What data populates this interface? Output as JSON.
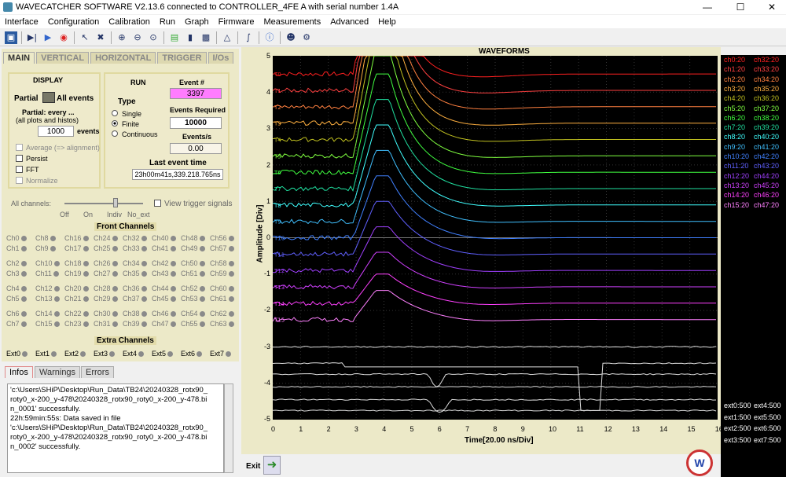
{
  "window": {
    "title": "WAVECATCHER SOFTWARE V2.13.6 connected to CONTROLLER_4FE A with serial number 1.4A"
  },
  "menu": [
    "Interface",
    "Configuration",
    "Calibration",
    "Run",
    "Graph",
    "Firmware",
    "Measurements",
    "Advanced",
    "Help"
  ],
  "tabs": [
    "MAIN",
    "VERTICAL",
    "HORIZONTAL",
    "TRIGGER",
    "I/Os"
  ],
  "display": {
    "header": "DISPLAY",
    "partial": "Partial",
    "all_events": "All events",
    "partial_every": "Partial: every ...",
    "all_plots": "(all plots and histos)",
    "events_value": "1000",
    "events_label": "events",
    "average": "Average (=> alignment)",
    "persist": "Persist",
    "fft": "FFT",
    "normalize": "Normalize"
  },
  "run": {
    "header": "RUN",
    "type": "Type",
    "single": "Single",
    "finite": "Finite",
    "continuous": "Continuous",
    "event_num_label": "Event #",
    "event_num": "3397",
    "events_required_label": "Events Required",
    "events_required": "10000",
    "events_per_s_label": "Events/s",
    "events_per_s": "0.00",
    "last_event_label": "Last event time",
    "last_event": "23h00m41s,339.218.765ns"
  },
  "channels": {
    "all_channels": "All channels:",
    "off": "Off",
    "on": "On",
    "indiv": "Indiv",
    "no_ext": "No_ext",
    "view_trigger": "View trigger signals",
    "front": "Front Channels",
    "extra": "Extra Channels",
    "rows": [
      [
        "Ch0",
        "Ch8",
        "Ch16",
        "Ch24",
        "Ch32",
        "Ch40",
        "Ch48",
        "Ch56"
      ],
      [
        "Ch1",
        "Ch9",
        "Ch17",
        "Ch25",
        "Ch33",
        "Ch41",
        "Ch49",
        "Ch57"
      ],
      [
        "Ch2",
        "Ch10",
        "Ch18",
        "Ch26",
        "Ch34",
        "Ch42",
        "Ch50",
        "Ch58"
      ],
      [
        "Ch3",
        "Ch11",
        "Ch19",
        "Ch27",
        "Ch35",
        "Ch43",
        "Ch51",
        "Ch59"
      ],
      [
        "Ch4",
        "Ch12",
        "Ch20",
        "Ch28",
        "Ch36",
        "Ch44",
        "Ch52",
        "Ch60"
      ],
      [
        "Ch5",
        "Ch13",
        "Ch21",
        "Ch29",
        "Ch37",
        "Ch45",
        "Ch53",
        "Ch61"
      ],
      [
        "Ch6",
        "Ch14",
        "Ch22",
        "Ch30",
        "Ch38",
        "Ch46",
        "Ch54",
        "Ch62"
      ],
      [
        "Ch7",
        "Ch15",
        "Ch23",
        "Ch31",
        "Ch39",
        "Ch47",
        "Ch55",
        "Ch63"
      ]
    ],
    "ext": [
      "Ext0",
      "Ext1",
      "Ext2",
      "Ext3",
      "Ext4",
      "Ext5",
      "Ext6",
      "Ext7"
    ]
  },
  "info_tabs": [
    "Infos",
    "Warnings",
    "Errors"
  ],
  "info_lines": [
    "'c:\\Users\\SHiP\\Desktop\\Run_Data\\TB24\\20240328_rotx90_",
    "roty0_x-200_y-478\\20240328_rotx90_roty0_x-200_y-478.bi",
    "n_0001' successfully.",
    "22h:59min:55s: Data saved in file",
    "'c:\\Users\\SHiP\\Desktop\\Run_Data\\TB24\\20240328_rotx90_",
    "roty0_x-200_y-478\\20240328_rotx90_roty0_x-200_y-478.bi",
    "n_0002' successfully."
  ],
  "plot": {
    "title": "WAVEFORMS",
    "ylabel": "Amplitude [Div]",
    "xlabel": "Time[20.00 ns/Div]",
    "yticks": [
      "5",
      "4",
      "3",
      "2",
      "1",
      "0",
      "-1",
      "-2",
      "-3",
      "-4",
      "-5"
    ],
    "xticks": [
      "0",
      "1",
      "2",
      "3",
      "4",
      "5",
      "6",
      "7",
      "8",
      "9",
      "10",
      "11",
      "12",
      "13",
      "14",
      "15",
      "16"
    ],
    "trace_tags": [
      "T0",
      "T1",
      "T2",
      "T3",
      "T4",
      "T5",
      "T6",
      "T7",
      "T8",
      "T9",
      "T10",
      "T11",
      "T12",
      "T13",
      "T14",
      "T15"
    ]
  },
  "legend": [
    [
      "ch0:20",
      "ch32:20"
    ],
    [
      "ch1:20",
      "ch33:20"
    ],
    [
      "ch2:20",
      "ch34:20"
    ],
    [
      "ch3:20",
      "ch35:20"
    ],
    [
      "ch4:20",
      "ch36:20"
    ],
    [
      "ch5:20",
      "ch37:20"
    ],
    [
      "ch6:20",
      "ch38:20"
    ],
    [
      "ch7:20",
      "ch39:20"
    ],
    [
      "ch8:20",
      "ch40:20"
    ],
    [
      "ch9:20",
      "ch41:20"
    ],
    [
      "ch10:20",
      "ch42:20"
    ],
    [
      "ch11:20",
      "ch43:20"
    ],
    [
      "ch12:20",
      "ch44:20"
    ],
    [
      "ch13:20",
      "ch45:20"
    ],
    [
      "ch14:20",
      "ch46:20"
    ],
    [
      "ch15:20",
      "ch47:20"
    ]
  ],
  "legend_colors": [
    "#ff2020",
    "#ff4040",
    "#ff8040",
    "#ffb040",
    "#c0c020",
    "#80ff40",
    "#40ff40",
    "#20e0a0",
    "#40ffff",
    "#40c0ff",
    "#4080ff",
    "#6060ff",
    "#a040ff",
    "#d040ff",
    "#ff40ff",
    "#ff80ff"
  ],
  "ext_legend": [
    [
      "ext0:500",
      "ext4:500"
    ],
    [
      "ext1:500",
      "ext5:500"
    ],
    [
      "ext2:500",
      "ext6:500"
    ],
    [
      "ext3:500",
      "ext7:500"
    ]
  ],
  "exit": "Exit"
}
